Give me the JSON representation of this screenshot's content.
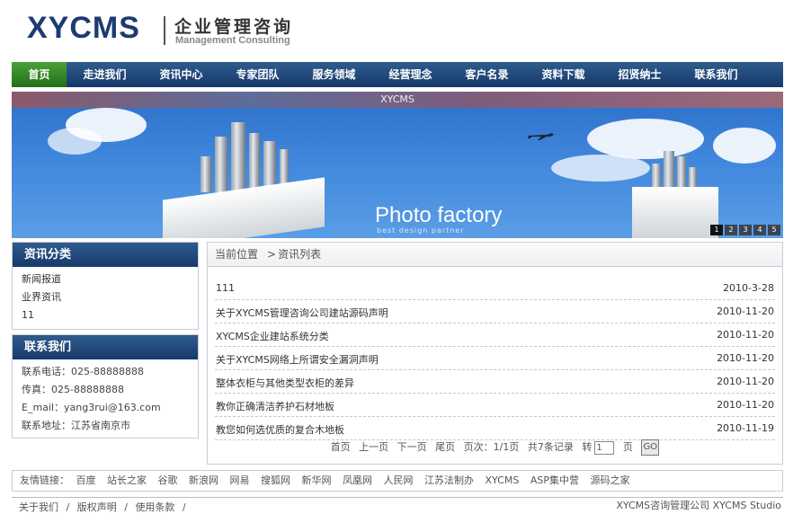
{
  "logo": {
    "main": "XYCMS",
    "cn": "企业管理咨询",
    "en": "Management Consulting"
  },
  "nav": [
    "首页",
    "走进我们",
    "资讯中心",
    "专家团队",
    "服务领域",
    "经营理念",
    "客户名录",
    "资料下载",
    "招贤纳士",
    "联系我们"
  ],
  "banner": {
    "title_bar": "XYCMS",
    "headline": "Photo factory",
    "subline": "best design partner",
    "slides": [
      "1",
      "2",
      "3",
      "4",
      "5"
    ]
  },
  "category": {
    "title": "资讯分类",
    "items": [
      "新闻报道",
      "业界资讯",
      "11"
    ]
  },
  "contact": {
    "title": "联系我们",
    "lines": [
      "联系电话：025-88888888",
      "传真：025-88888888",
      "E_mail：yang3rui@163.com",
      "联系地址：江苏省南京市"
    ]
  },
  "breadcrumb": {
    "current": "当前位置",
    "sep": ">",
    "page": "资讯列表"
  },
  "articles": [
    {
      "title": "111",
      "date": "2010-3-28"
    },
    {
      "title": "关于XYCMS管理咨询公司建站源码声明",
      "date": "2010-11-20"
    },
    {
      "title": "XYCMS企业建站系统分类",
      "date": "2010-11-20"
    },
    {
      "title": "关于XYCMS网络上所谓安全漏洞声明",
      "date": "2010-11-20"
    },
    {
      "title": "整体衣柜与其他类型衣柜的差异",
      "date": "2010-11-20"
    },
    {
      "title": "教你正确清洁养护石材地板",
      "date": "2010-11-20"
    },
    {
      "title": "教您如何选优质的复合木地板",
      "date": "2010-11-19"
    }
  ],
  "pager": {
    "first": "首页",
    "prev": "上一页",
    "next": "下一页",
    "last": "尾页",
    "info": "页次：1/1页",
    "total": "共7条记录",
    "goto": "转",
    "input": "1",
    "page_unit": "页",
    "go": "GO"
  },
  "links": {
    "label": "友情链接：",
    "items": [
      "百度",
      "站长之家",
      "谷歌",
      "新浪网",
      "网易",
      "搜狐网",
      "新华网",
      "凤凰网",
      "人民网",
      "江苏法制办",
      "XYCMS",
      "ASP集中营",
      "源码之家"
    ]
  },
  "footer": {
    "left": [
      "关于我们",
      "/",
      "版权声明",
      "/",
      "使用条款",
      "/"
    ],
    "right": "XYCMS咨询管理公司  XYCMS Studio"
  }
}
